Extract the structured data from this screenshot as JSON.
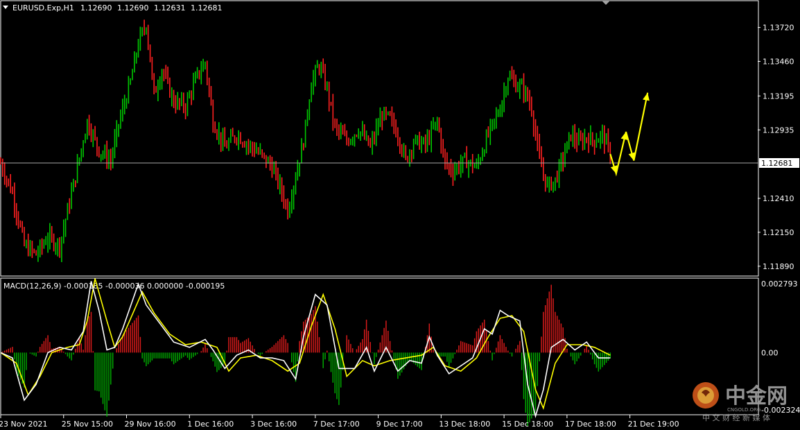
{
  "chart_data": [
    {
      "type": "candlestick",
      "symbol_header": "EURUSD.Exp,H1",
      "ohlc_readout": [
        "1.12690",
        "1.12690",
        "1.12631",
        "1.12681"
      ],
      "current_price_label": "1.12681",
      "current_price": 1.12681,
      "y_ticks": [
        "1.13720",
        "1.13460",
        "1.13195",
        "1.12935",
        "1.12681",
        "1.12410",
        "1.12150",
        "1.11890"
      ],
      "ylim": [
        1.1182,
        1.1392
      ],
      "up_color": "#00c800",
      "down_color": "#ff2020",
      "hourly_close_path": [
        [
          0,
          1.1268
        ],
        [
          6,
          1.1245
        ],
        [
          12,
          1.1205
        ],
        [
          18,
          1.1198
        ],
        [
          24,
          1.1211
        ],
        [
          30,
          1.1205
        ],
        [
          38,
          1.1258
        ],
        [
          44,
          1.13
        ],
        [
          50,
          1.1278
        ],
        [
          56,
          1.127
        ],
        [
          60,
          1.1298
        ],
        [
          66,
          1.133
        ],
        [
          70,
          1.136
        ],
        [
          74,
          1.1375
        ],
        [
          78,
          1.132
        ],
        [
          82,
          1.134
        ],
        [
          88,
          1.1315
        ],
        [
          94,
          1.1312
        ],
        [
          100,
          1.1335
        ],
        [
          104,
          1.1345
        ],
        [
          108,
          1.13
        ],
        [
          114,
          1.128
        ],
        [
          120,
          1.129
        ],
        [
          126,
          1.1282
        ],
        [
          132,
          1.1275
        ],
        [
          138,
          1.1265
        ],
        [
          142,
          1.125
        ],
        [
          146,
          1.1232
        ],
        [
          150,
          1.1258
        ],
        [
          154,
          1.1285
        ],
        [
          158,
          1.133
        ],
        [
          162,
          1.1343
        ],
        [
          166,
          1.1325
        ],
        [
          170,
          1.1295
        ],
        [
          176,
          1.1285
        ],
        [
          182,
          1.1294
        ],
        [
          188,
          1.128
        ],
        [
          194,
          1.1305
        ],
        [
          198,
          1.1302
        ],
        [
          202,
          1.129
        ],
        [
          206,
          1.127
        ],
        [
          210,
          1.1285
        ],
        [
          216,
          1.1282
        ],
        [
          222,
          1.13
        ],
        [
          226,
          1.1268
        ],
        [
          230,
          1.1262
        ],
        [
          236,
          1.127
        ],
        [
          242,
          1.1265
        ],
        [
          248,
          1.129
        ],
        [
          254,
          1.131
        ],
        [
          258,
          1.1335
        ],
        [
          262,
          1.1328
        ],
        [
          266,
          1.1325
        ],
        [
          270,
          1.131
        ],
        [
          274,
          1.127
        ],
        [
          278,
          1.125
        ],
        [
          282,
          1.1255
        ],
        [
          286,
          1.1272
        ],
        [
          290,
          1.129
        ],
        [
          294,
          1.1283
        ],
        [
          298,
          1.1288
        ],
        [
          302,
          1.1285
        ],
        [
          306,
          1.129
        ],
        [
          310,
          1.1275
        ]
      ],
      "forecast_arrow": [
        [
          310,
          1.1275
        ],
        [
          313,
          1.126
        ],
        [
          318,
          1.1292
        ],
        [
          322,
          1.127
        ],
        [
          329,
          1.1322
        ]
      ]
    },
    {
      "type": "macd",
      "header": "MACD(12,26,9) -0.000185 -0.000036 0.000000 -0.000195",
      "y_ticks": [
        "0.002793",
        "0.00",
        "-0.002324"
      ],
      "ylim": [
        -0.002324,
        0.002793
      ],
      "macd_line_color": "#ffffff",
      "signal_line_color": "#ffff00",
      "macd_line": [
        [
          0,
          0.0
        ],
        [
          6,
          -0.0002
        ],
        [
          12,
          -0.0018
        ],
        [
          18,
          -0.0012
        ],
        [
          24,
          0.0
        ],
        [
          30,
          0.0002
        ],
        [
          36,
          0.0001
        ],
        [
          42,
          0.0008
        ],
        [
          46,
          0.0027
        ],
        [
          50,
          0.0016
        ],
        [
          54,
          0.0001
        ],
        [
          58,
          0.0002
        ],
        [
          62,
          0.0009
        ],
        [
          70,
          0.0026
        ],
        [
          74,
          0.0018
        ],
        [
          80,
          0.0012
        ],
        [
          88,
          0.0004
        ],
        [
          96,
          0.0002
        ],
        [
          104,
          0.0005
        ],
        [
          108,
          0.0001
        ],
        [
          114,
          -0.0006
        ],
        [
          120,
          -0.0001
        ],
        [
          126,
          0.0001
        ],
        [
          132,
          -0.0002
        ],
        [
          138,
          -0.0002
        ],
        [
          144,
          -0.0003
        ],
        [
          150,
          -0.001
        ],
        [
          154,
          0.0006
        ],
        [
          160,
          0.0022
        ],
        [
          166,
          0.0018
        ],
        [
          172,
          -0.0006
        ],
        [
          180,
          -0.0006
        ],
        [
          186,
          0.0002
        ],
        [
          190,
          -0.0007
        ],
        [
          196,
          0.0002
        ],
        [
          202,
          -0.0007
        ],
        [
          208,
          -0.0003
        ],
        [
          214,
          -0.0004
        ],
        [
          218,
          0.0006
        ],
        [
          222,
          -0.0001
        ],
        [
          228,
          -0.0008
        ],
        [
          234,
          -0.0005
        ],
        [
          240,
          -0.0002
        ],
        [
          246,
          0.0009
        ],
        [
          250,
          0.0007
        ],
        [
          254,
          0.0016
        ],
        [
          258,
          0.0014
        ],
        [
          264,
          0.0012
        ],
        [
          268,
          -0.0012
        ],
        [
          272,
          -0.0024
        ],
        [
          276,
          -0.0014
        ],
        [
          280,
          0.0002
        ],
        [
          286,
          0.0005
        ],
        [
          292,
          0.0001
        ],
        [
          298,
          0.0004
        ],
        [
          304,
          -0.0002
        ],
        [
          310,
          -0.0002
        ]
      ],
      "signal_line": [
        [
          0,
          0.0
        ],
        [
          8,
          -0.0004
        ],
        [
          14,
          -0.0016
        ],
        [
          20,
          -0.0009
        ],
        [
          26,
          0.0
        ],
        [
          34,
          0.0002
        ],
        [
          40,
          0.0003
        ],
        [
          44,
          0.0012
        ],
        [
          48,
          0.0028
        ],
        [
          54,
          0.0012
        ],
        [
          58,
          0.0002
        ],
        [
          62,
          0.0006
        ],
        [
          72,
          0.0023
        ],
        [
          78,
          0.0015
        ],
        [
          86,
          0.0007
        ],
        [
          94,
          0.0003
        ],
        [
          102,
          0.0004
        ],
        [
          110,
          0.0002
        ],
        [
          116,
          -0.0007
        ],
        [
          122,
          -0.0002
        ],
        [
          130,
          -0.0001
        ],
        [
          138,
          -0.0003
        ],
        [
          146,
          -0.0007
        ],
        [
          152,
          -0.0004
        ],
        [
          158,
          0.001
        ],
        [
          164,
          0.0022
        ],
        [
          170,
          0.0009
        ],
        [
          176,
          -0.0009
        ],
        [
          184,
          -0.0003
        ],
        [
          190,
          -0.0005
        ],
        [
          198,
          -0.0003
        ],
        [
          206,
          -0.0002
        ],
        [
          214,
          -0.0001
        ],
        [
          220,
          0.0002
        ],
        [
          226,
          -0.0005
        ],
        [
          234,
          -0.0007
        ],
        [
          242,
          -0.0002
        ],
        [
          248,
          0.0006
        ],
        [
          254,
          0.0013
        ],
        [
          260,
          0.0014
        ],
        [
          266,
          0.0008
        ],
        [
          272,
          -0.0014
        ],
        [
          276,
          -0.0021
        ],
        [
          282,
          -0.0004
        ],
        [
          288,
          0.0003
        ],
        [
          296,
          0.0003
        ],
        [
          302,
          0.0002
        ],
        [
          310,
          -0.0001
        ]
      ]
    }
  ],
  "x_axis": {
    "labels": [
      "23 Nov 2021",
      "25 Nov 15:00",
      "29 Nov 16:00",
      "1 Dec 16:00",
      "3 Dec 16:00",
      "7 Dec 17:00",
      "9 Dec 17:00",
      "13 Dec 18:00",
      "15 Dec 18:00",
      "17 Dec 18:00",
      "21 Dec 19:00"
    ],
    "label_hours": [
      0,
      32,
      64,
      96,
      128,
      160,
      192,
      224,
      256,
      288,
      320
    ],
    "xlim": [
      0,
      385
    ]
  },
  "watermark": {
    "brand": "中金网",
    "domain": "CNGOLD.ORG",
    "tagline": "中 文 财 经 新 媒 体"
  }
}
